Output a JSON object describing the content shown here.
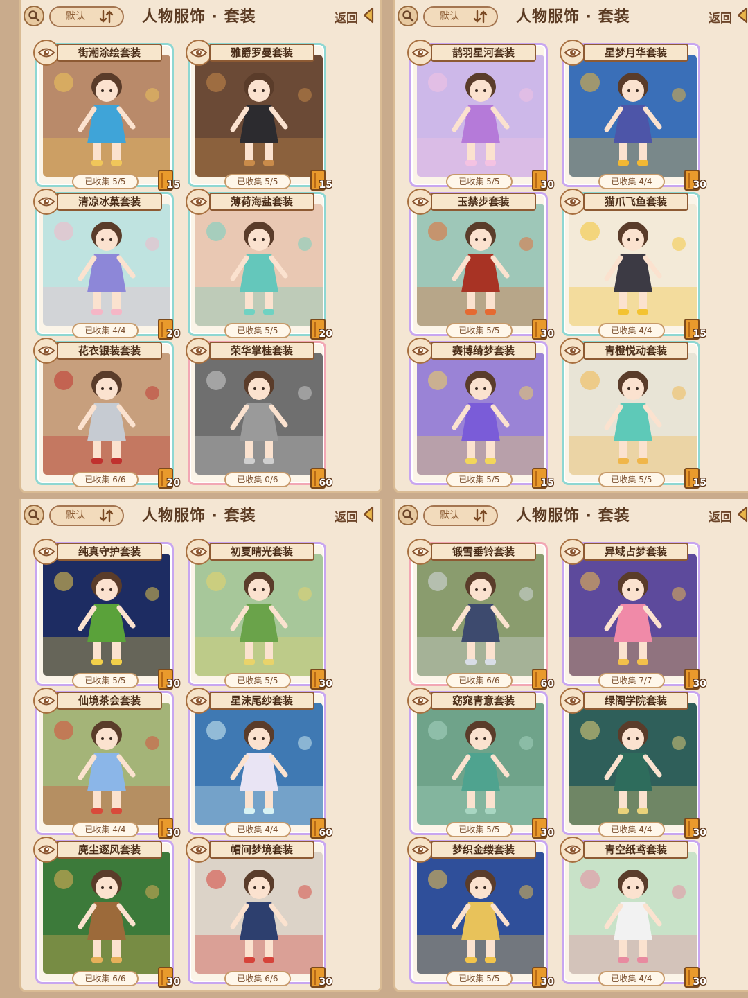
{
  "panels": [
    {
      "sort_label": "默认",
      "title": "人物服饰 · 套装",
      "back_label": "返回",
      "cards": [
        {
          "name": "街潮涂绘套装",
          "collected": "已收集 5/5",
          "cost": "15",
          "frame": "#8ed7d2",
          "bg": "#b98a6a",
          "accent": "#f0c65a",
          "figure": "#3fa4d8"
        },
        {
          "name": "雅爵罗曼套装",
          "collected": "已收集 5/5",
          "cost": "15",
          "frame": "#8ed7d2",
          "bg": "#6b4a36",
          "accent": "#c98b4a",
          "figure": "#2c2b2f"
        },
        {
          "name": "清凉冰菓套装",
          "collected": "已收集 4/4",
          "cost": "20",
          "frame": "#8ed7d2",
          "bg": "#bfe3e0",
          "accent": "#f5b6c6",
          "figure": "#8d87d8"
        },
        {
          "name": "薄荷海盐套装",
          "collected": "已收集 5/5",
          "cost": "20",
          "frame": "#8ed7d2",
          "bg": "#e9c8b3",
          "accent": "#6fd2c2",
          "figure": "#64c7bb"
        },
        {
          "name": "花衣银装套装",
          "collected": "已收集 6/6",
          "cost": "20",
          "frame": "#8ed7d2",
          "bg": "#c79f7d",
          "accent": "#c0312e",
          "figure": "#c6cbd2"
        },
        {
          "name": "荣华掌桂套装",
          "collected": "已收集 0/6",
          "cost": "60",
          "frame": "#f2a7b4",
          "bg": "#6f6f6f",
          "accent": "#cfcfcf",
          "figure": "#9a9a9a"
        }
      ]
    },
    {
      "sort_label": "默认",
      "title": "人物服饰 · 套装",
      "back_label": "返回",
      "cards": [
        {
          "name": "鹊羽星河套装",
          "collected": "已收集 5/5",
          "cost": "30",
          "frame": "#c8a6f0",
          "bg": "#cdb8e9",
          "accent": "#f4c2e2",
          "figure": "#b57ad9"
        },
        {
          "name": "星梦月华套装",
          "collected": "已收集 4/4",
          "cost": "30",
          "frame": "#c8a6f0",
          "bg": "#3a6fb8",
          "accent": "#f2b833",
          "figure": "#4d55a8"
        },
        {
          "name": "玉禁步套装",
          "collected": "已收集 5/5",
          "cost": "30",
          "frame": "#c8a6f0",
          "bg": "#9ec7b8",
          "accent": "#e56a32",
          "figure": "#a83324"
        },
        {
          "name": "猫爪飞鱼套装",
          "collected": "已收集 4/4",
          "cost": "15",
          "frame": "#8ed7d2",
          "bg": "#f3ead8",
          "accent": "#f3c332",
          "figure": "#3c3a44"
        },
        {
          "name": "赛博绮梦套装",
          "collected": "已收集 5/5",
          "cost": "15",
          "frame": "#c8a6f0",
          "bg": "#9a83d6",
          "accent": "#f2d65a",
          "figure": "#7a5cd8"
        },
        {
          "name": "青橙悦动套装",
          "collected": "已收集 5/5",
          "cost": "15",
          "frame": "#8ed7d2",
          "bg": "#e8e4d6",
          "accent": "#f0b64a",
          "figure": "#5ec9b8"
        }
      ]
    },
    {
      "sort_label": "默认",
      "title": "人物服饰 · 套装",
      "back_label": "返回",
      "cards": [
        {
          "name": "纯真守护套装",
          "collected": "已收集 5/5",
          "cost": "30",
          "frame": "#c8a6f0",
          "bg": "#1d2c62",
          "accent": "#f2d04a",
          "figure": "#5aa23a"
        },
        {
          "name": "初夏晴光套装",
          "collected": "已收集 5/5",
          "cost": "30",
          "frame": "#c8a6f0",
          "bg": "#a7c79a",
          "accent": "#e9d36a",
          "figure": "#6aa34a"
        },
        {
          "name": "仙境茶会套装",
          "collected": "已收集 4/4",
          "cost": "30",
          "frame": "#c8a6f0",
          "bg": "#a4b478",
          "accent": "#d84a3a",
          "figure": "#8bb6e8"
        },
        {
          "name": "星沫尾纱套装",
          "collected": "已收集 4/4",
          "cost": "60",
          "frame": "#c8a6f0",
          "bg": "#3f79b3",
          "accent": "#d7f2f4",
          "figure": "#e9e4f4"
        },
        {
          "name": "麂尘逐风套装",
          "collected": "已收集 6/6",
          "cost": "30",
          "frame": "#c8a6f0",
          "bg": "#3c7a3a",
          "accent": "#e6b05a",
          "figure": "#9c6a3a"
        },
        {
          "name": "帽间梦境套装",
          "collected": "已收集 6/6",
          "cost": "30",
          "frame": "#c8a6f0",
          "bg": "#dcd3c8",
          "accent": "#d6433a",
          "figure": "#2d3f6e"
        }
      ]
    },
    {
      "sort_label": "默认",
      "title": "人物服饰 · 套装",
      "back_label": "返回",
      "cards": [
        {
          "name": "锻雪垂铃套装",
          "collected": "已收集 6/6",
          "cost": "60",
          "frame": "#f2a7b4",
          "bg": "#8a9c6e",
          "accent": "#d8dde6",
          "figure": "#3d4a6e"
        },
        {
          "name": "异域占梦套装",
          "collected": "已收集 7/7",
          "cost": "30",
          "frame": "#c8a6f0",
          "bg": "#5d4a9c",
          "accent": "#f2c04a",
          "figure": "#f08aa8"
        },
        {
          "name": "窈窕青意套装",
          "collected": "已收集 5/5",
          "cost": "30",
          "frame": "#c8a6f0",
          "bg": "#6fa38a",
          "accent": "#a8d6c2",
          "figure": "#4fa38f"
        },
        {
          "name": "绿阁学院套装",
          "collected": "已收集 4/4",
          "cost": "30",
          "frame": "#c8a6f0",
          "bg": "#2f5f5a",
          "accent": "#e9d27a",
          "figure": "#2e6c5c"
        },
        {
          "name": "梦织金缕套装",
          "collected": "已收集 5/5",
          "cost": "30",
          "frame": "#c8a6f0",
          "bg": "#2f4f9a",
          "accent": "#f2c44a",
          "figure": "#e8c25a"
        },
        {
          "name": "青空纸鸢套装",
          "collected": "已收集 4/4",
          "cost": "30",
          "frame": "#c8a6f0",
          "bg": "#c8e2c8",
          "accent": "#e88aa0",
          "figure": "#f2f2f2"
        }
      ]
    }
  ]
}
